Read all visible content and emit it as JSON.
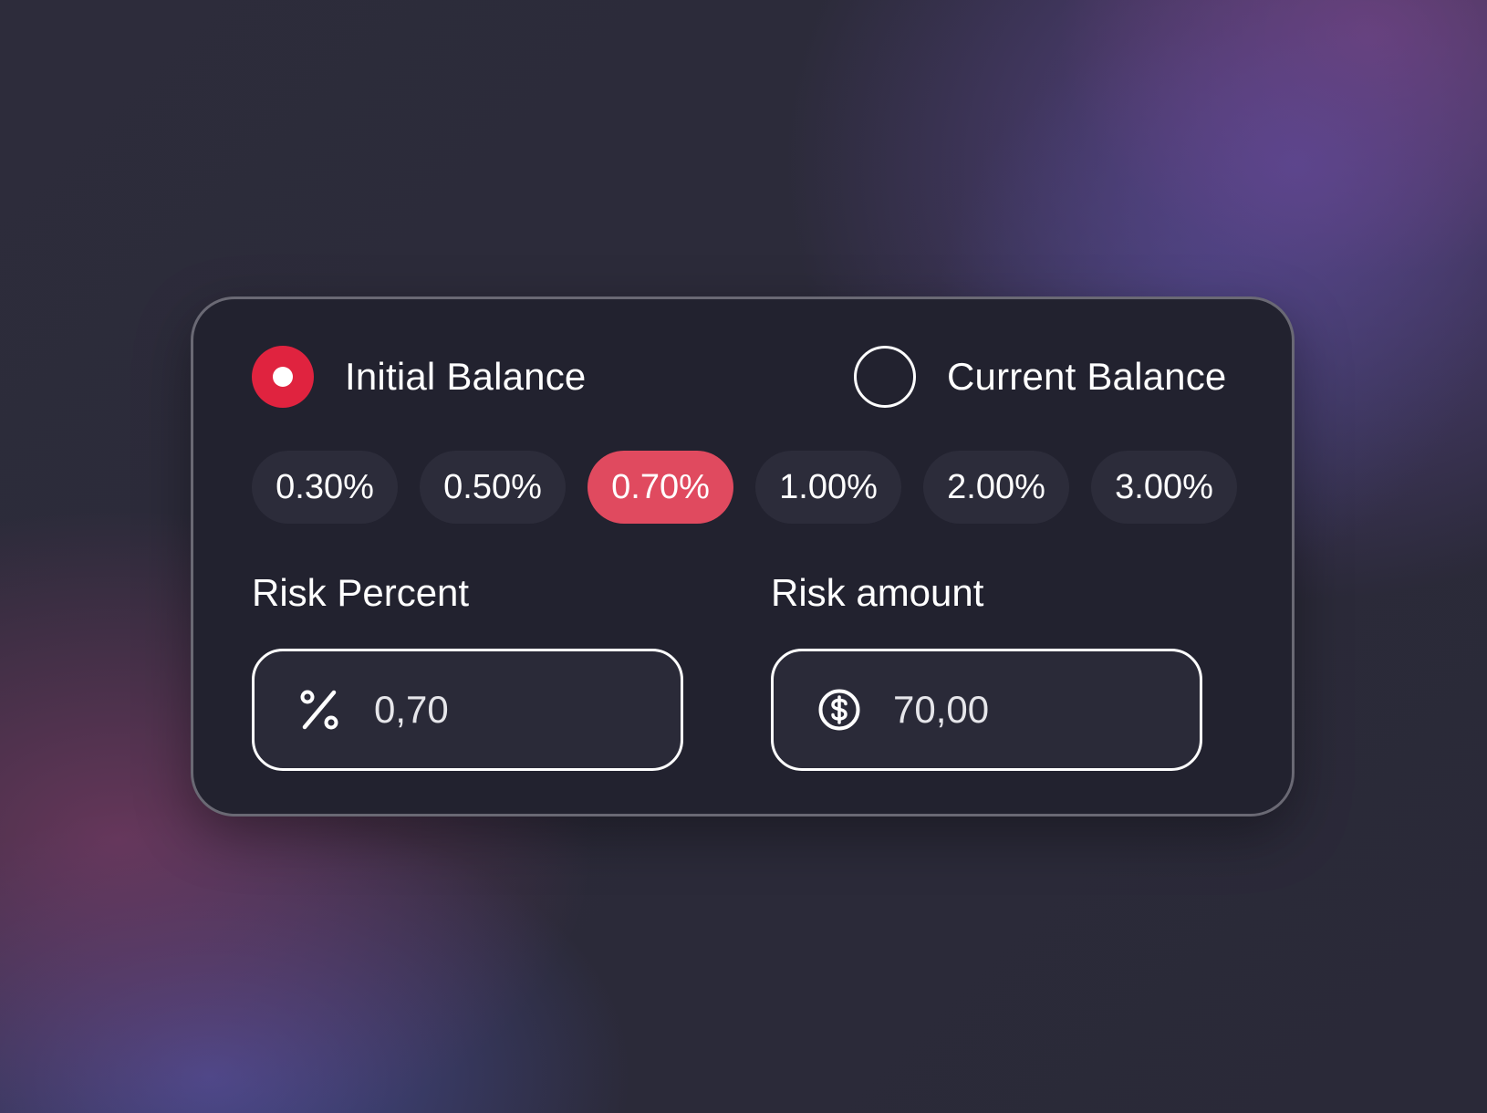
{
  "balance_mode": {
    "options": [
      {
        "label": "Initial Balance",
        "selected": true
      },
      {
        "label": "Current Balance",
        "selected": false
      }
    ]
  },
  "presets": {
    "items": [
      "0.30%",
      "0.50%",
      "0.70%",
      "1.00%",
      "2.00%",
      "3.00%"
    ],
    "active_index": 2
  },
  "risk_percent": {
    "label": "Risk Percent",
    "value": "0,70",
    "icon": "percent-icon"
  },
  "risk_amount": {
    "label": "Risk amount",
    "value": "70,00",
    "icon": "dollar-circle-icon"
  },
  "colors": {
    "accent_radio": "#e0233f",
    "accent_chip": "#e04a5f",
    "card_bg": "#22222f",
    "chip_bg": "#2c2c3a"
  }
}
